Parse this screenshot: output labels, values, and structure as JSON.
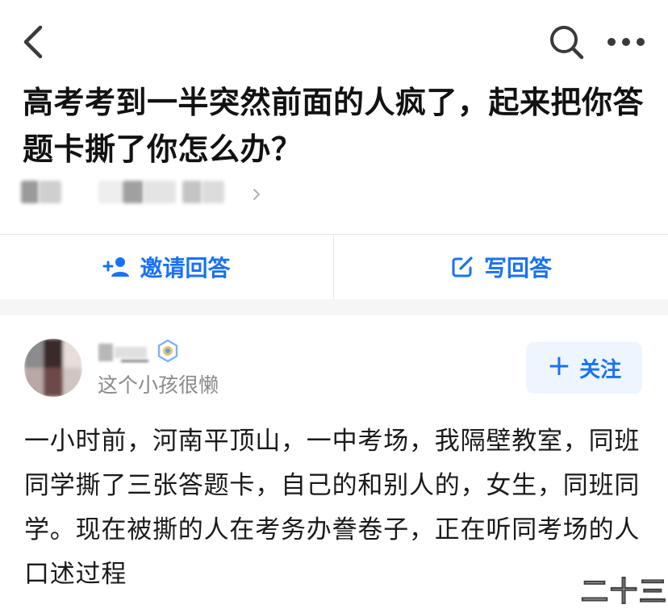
{
  "question": {
    "title": "高考考到一半突然前面的人疯了，起来把你答题卡撕了你怎么办？"
  },
  "actions": {
    "invite_label": "邀请回答",
    "write_label": "写回答"
  },
  "answer": {
    "author_bio": "这个小孩很懒",
    "follow_label": "关注",
    "text": "一小时前，河南平顶山，一中考场，我隔壁教室，同班同学撕了三张答题卡，自己的和别人的，女生，同班同学。现在被撕的人在考务办誊卷子，正在听同考场的人口述过程"
  },
  "watermark": "二十三",
  "colors": {
    "accent": "#1772f6",
    "follow_bg": "#eef5ff",
    "divider": "#e6e6e6",
    "muted_text": "#8a8a8a"
  },
  "icons": {
    "back": "chevron-left-icon",
    "search": "search-icon",
    "more": "more-horizontal-icon",
    "invite": "add-user-icon",
    "write": "edit-icon",
    "badge": "verified-badge-icon",
    "follow": "plus-icon"
  }
}
